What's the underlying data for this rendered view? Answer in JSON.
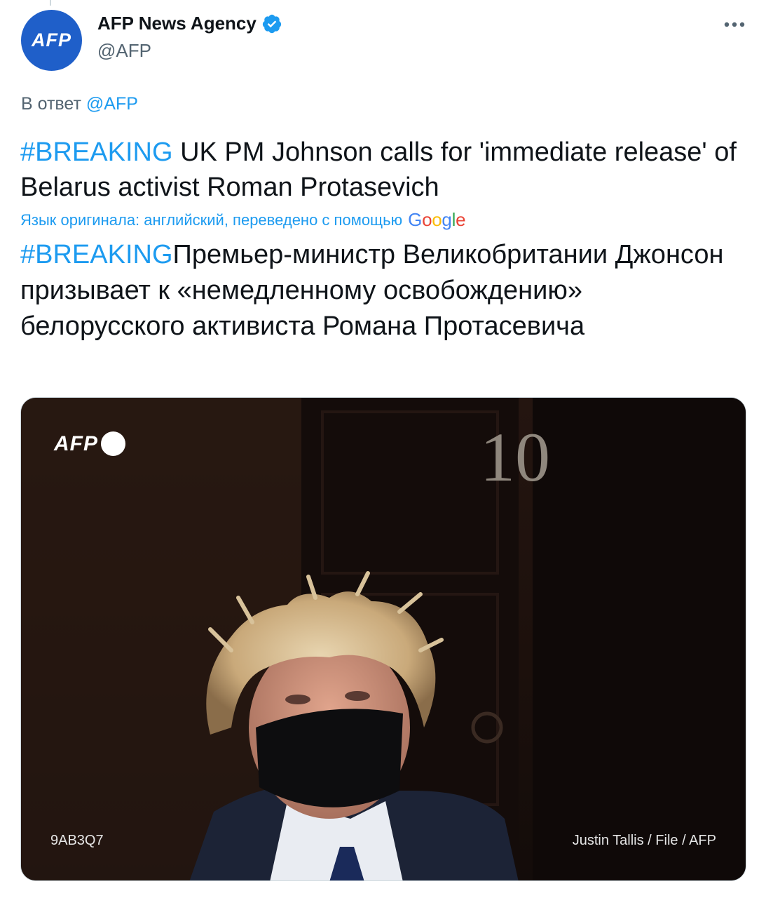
{
  "tweet": {
    "author": {
      "name": "AFP News Agency",
      "handle": "@AFP",
      "avatar_text": "AFP",
      "verified_icon": "verified-badge-icon"
    },
    "more_icon": "more-horizontal-icon",
    "reply": {
      "prefix": "В ответ",
      "mention": "@AFP"
    },
    "original": {
      "hashtag": "#BREAKING",
      "text": " UK PM Johnson calls for 'immediate release' of Belarus activist Roman Protasevich"
    },
    "translation_notice": {
      "text": "Язык оригинала: английский, переведено с помощью",
      "provider": "Google"
    },
    "translated": {
      "hashtag": "#BREAKING",
      "text": "Премьер-министр Великобритании Джонсон призывает к «немедленному освобождению» белорусского активиста Романа Протасевича"
    },
    "media": {
      "watermark": "AFP",
      "door_number": "10",
      "photo_id": "9AB3Q7",
      "credit": "Justin Tallis / File / AFP"
    }
  },
  "colors": {
    "accent": "#1d9bf0",
    "secondary_text": "#536471",
    "avatar_bg": "#1f5fc9",
    "google_blue": "#4285F4",
    "google_red": "#EA4335",
    "google_yellow": "#FBBC05",
    "google_green": "#34A853"
  }
}
